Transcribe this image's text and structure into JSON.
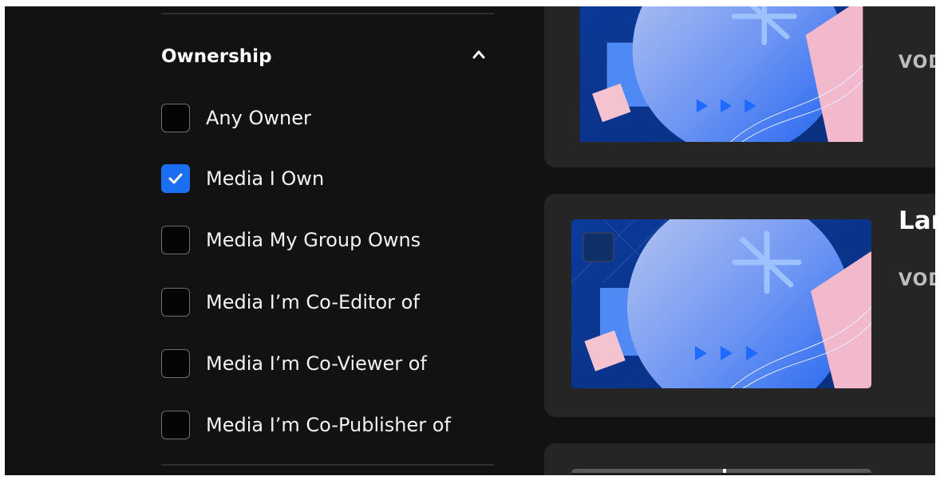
{
  "filter": {
    "section_title": "Ownership",
    "collapse_icon": "chevron-up-icon",
    "options": [
      {
        "label": "Any Owner",
        "checked": false
      },
      {
        "label": "Media I Own",
        "checked": true
      },
      {
        "label": "Media My Group Owns",
        "checked": false
      },
      {
        "label": "Media I’m Co-Editor of",
        "checked": false
      },
      {
        "label": "Media I’m Co-Viewer of",
        "checked": false
      },
      {
        "label": "Media I’m Co-Publisher of",
        "checked": false
      }
    ],
    "checkbox_checked_color": "#1a6ff2"
  },
  "cards": [
    {
      "type": "VOD"
    },
    {
      "title": "Lar",
      "type": "VOD"
    }
  ]
}
